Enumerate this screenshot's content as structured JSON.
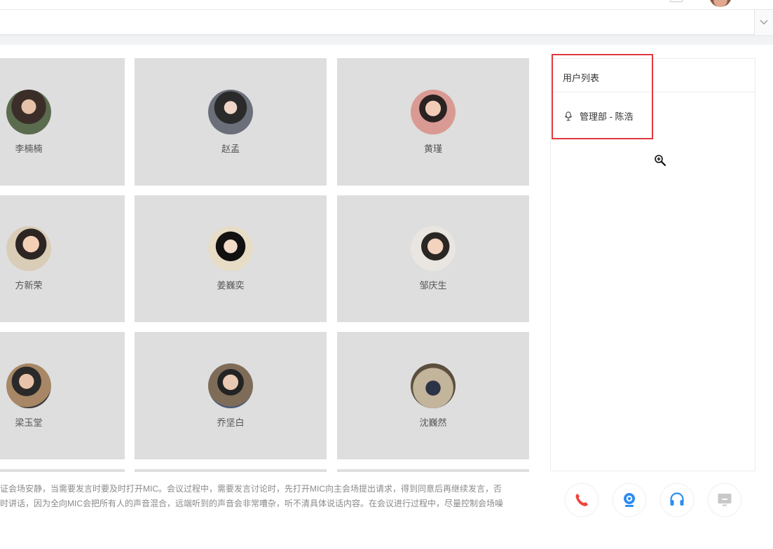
{
  "panel": {
    "title": "用户列表",
    "users": [
      {
        "name": "管理部 - 陈浩",
        "icon": "microphone-icon"
      }
    ]
  },
  "participants": [
    {
      "name": "李楠楠"
    },
    {
      "name": "赵孟"
    },
    {
      "name": "黄瑾"
    },
    {
      "name": "方新荣"
    },
    {
      "name": "姜巍奕"
    },
    {
      "name": "邹庆生"
    },
    {
      "name": "梁玉堂"
    },
    {
      "name": "乔坚白"
    },
    {
      "name": "沈巍然"
    }
  ],
  "notice": {
    "line1": "证会场安静，当需要发言时要及时打开MIC。会议过程中，需要发言讨论时，先打开MIC向主会场提出请求，得到同意后再继续发言，否",
    "line2": "时讲话，因为全向MIC会把所有人的声音混合，远端听到的声音会非常嘈杂，听不清具体说话内容。在会议进行过程中，尽量控制会场噪"
  },
  "controls": [
    {
      "icon": "phone-icon",
      "color": "#f0443a"
    },
    {
      "icon": "camera-icon",
      "color": "#2d8cf0"
    },
    {
      "icon": "headset-icon",
      "color": "#2d8cf0"
    },
    {
      "icon": "screen-icon",
      "color": "#c8c8c8"
    }
  ],
  "colors": {
    "highlight": "#e0393e",
    "tile": "#dedede"
  }
}
